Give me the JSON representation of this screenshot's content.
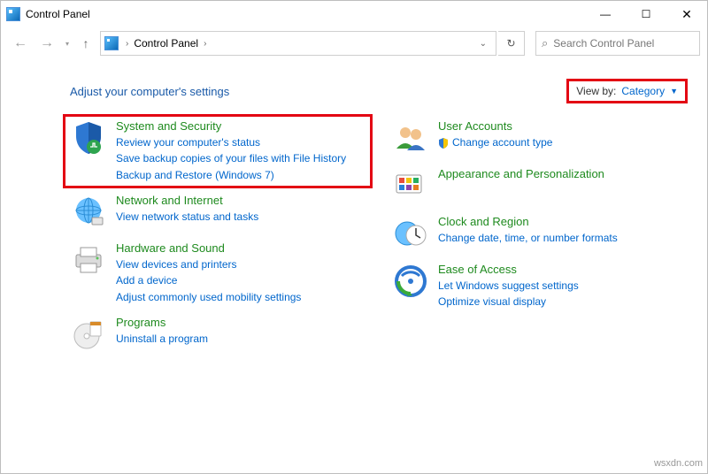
{
  "window": {
    "title": "Control Panel"
  },
  "breadcrumb": {
    "root": "Control Panel"
  },
  "search": {
    "placeholder": "Search Control Panel"
  },
  "header": {
    "title": "Adjust your computer's settings"
  },
  "viewby": {
    "label": "View by:",
    "value": "Category"
  },
  "left": [
    {
      "title": "System and Security",
      "links": [
        "Review your computer's status",
        "Save backup copies of your files with File History",
        "Backup and Restore (Windows 7)"
      ]
    },
    {
      "title": "Network and Internet",
      "links": [
        "View network status and tasks"
      ]
    },
    {
      "title": "Hardware and Sound",
      "links": [
        "View devices and printers",
        "Add a device",
        "Adjust commonly used mobility settings"
      ]
    },
    {
      "title": "Programs",
      "links": [
        "Uninstall a program"
      ]
    }
  ],
  "right": [
    {
      "title": "User Accounts",
      "links": [
        "Change account type"
      ]
    },
    {
      "title": "Appearance and Personalization",
      "links": []
    },
    {
      "title": "Clock and Region",
      "links": [
        "Change date, time, or number formats"
      ]
    },
    {
      "title": "Ease of Access",
      "links": [
        "Let Windows suggest settings",
        "Optimize visual display"
      ]
    }
  ],
  "watermark": "wsxdn.com"
}
